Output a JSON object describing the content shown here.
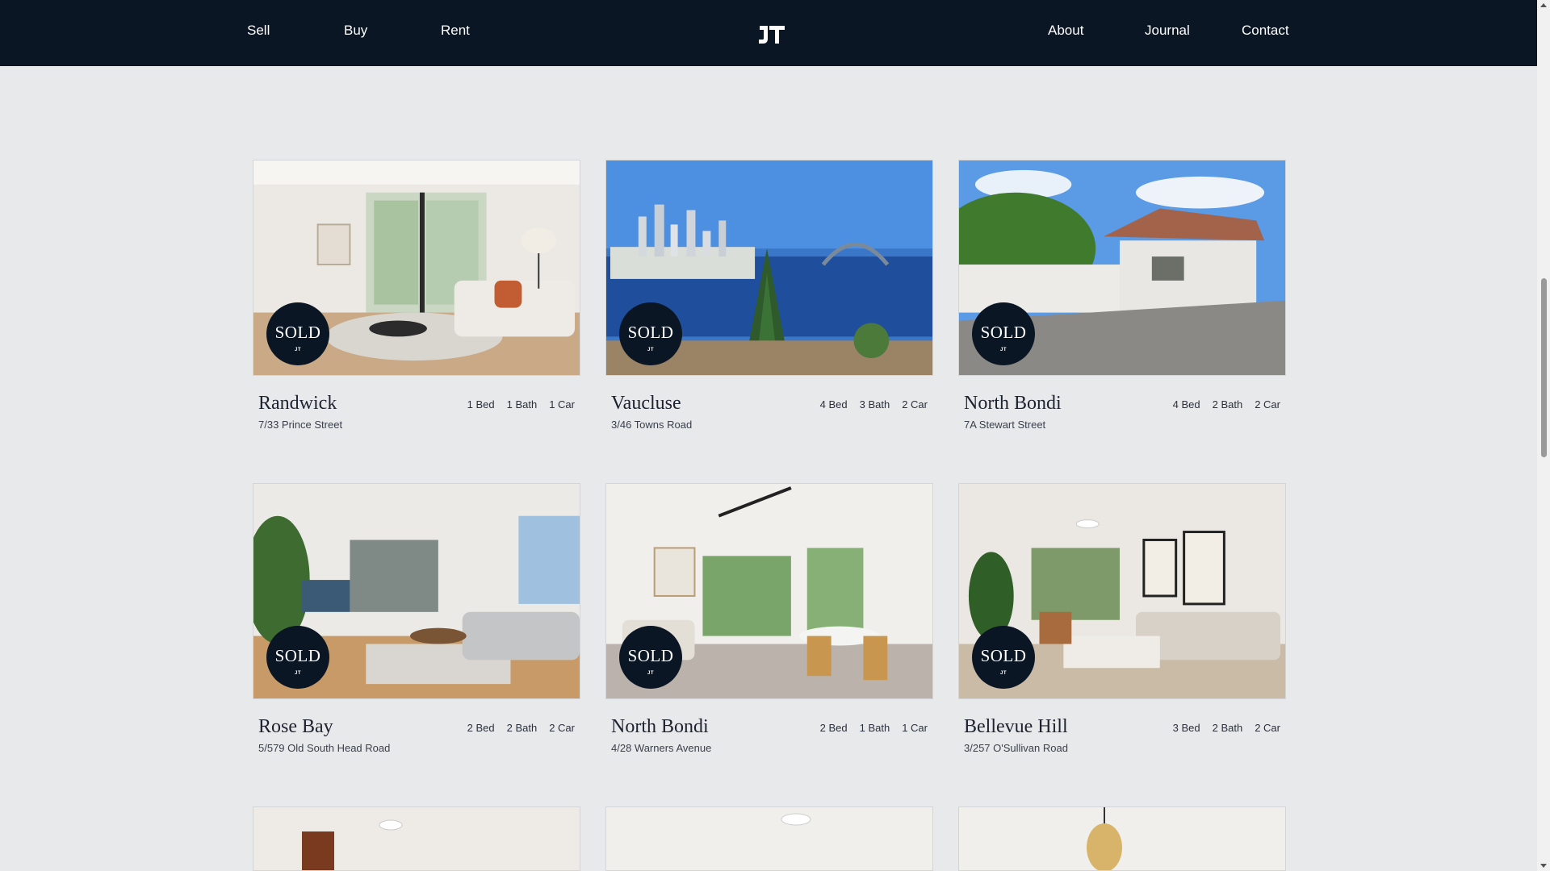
{
  "nav": {
    "left": [
      "Sell",
      "Buy",
      "Rent"
    ],
    "right": [
      "About",
      "Journal",
      "Contact"
    ],
    "logo_text": "JT"
  },
  "badge": {
    "label": "SOLD",
    "mini": "JT"
  },
  "listings": [
    {
      "suburb": "Randwick",
      "address": "7/33 Prince Street",
      "bed": "1 Bed",
      "bath": "1 Bath",
      "car": "1 Car",
      "status": "SOLD"
    },
    {
      "suburb": "Vaucluse",
      "address": "3/46 Towns Road",
      "bed": "4 Bed",
      "bath": "3 Bath",
      "car": "2 Car",
      "status": "SOLD"
    },
    {
      "suburb": "North Bondi",
      "address": "7A Stewart Street",
      "bed": "4 Bed",
      "bath": "2 Bath",
      "car": "2 Car",
      "status": "SOLD"
    },
    {
      "suburb": "Rose Bay",
      "address": "5/579 Old South Head Road",
      "bed": "2 Bed",
      "bath": "2 Bath",
      "car": "2 Car",
      "status": "SOLD"
    },
    {
      "suburb": "North Bondi",
      "address": "4/28 Warners Avenue",
      "bed": "2 Bed",
      "bath": "1 Bath",
      "car": "1 Car",
      "status": "SOLD"
    },
    {
      "suburb": "Bellevue Hill",
      "address": "3/257 O'Sullivan Road",
      "bed": "3 Bed",
      "bath": "2 Bath",
      "car": "2 Car",
      "status": "SOLD"
    }
  ],
  "colors": {
    "navbar": "#0b1624",
    "background": "#e8e9eb",
    "badge": "#0b1624"
  }
}
